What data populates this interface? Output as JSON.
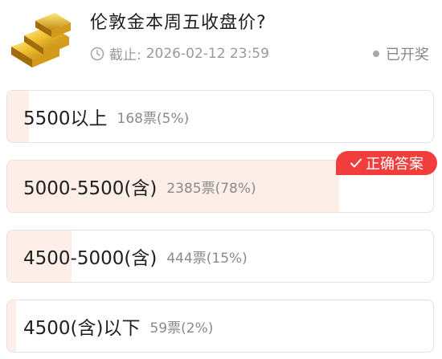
{
  "poll": {
    "title": "伦敦金本周五收盘价?",
    "deadline_label": "截止:",
    "deadline": "2026-02-12 23:59",
    "status": "已开奖",
    "correct_badge": "正确答案",
    "options": [
      {
        "label": "5500以上",
        "votes": "168票(5%)",
        "percent": 5,
        "correct": false
      },
      {
        "label": "5000-5500(含)",
        "votes": "2385票(78%)",
        "percent": 78,
        "correct": true
      },
      {
        "label": "4500-5000(含)",
        "votes": "444票(15%)",
        "percent": 15,
        "correct": false
      },
      {
        "label": "4500(含)以下",
        "votes": "59票(2%)",
        "percent": 2,
        "correct": false
      }
    ]
  },
  "colors": {
    "fill": "#fdeee7",
    "badge": "#f23d3d",
    "muted_text": "#9a9a9a"
  },
  "icons": {
    "header_image": "gold-bars-icon",
    "deadline": "clock-icon",
    "badge": "check-icon"
  }
}
